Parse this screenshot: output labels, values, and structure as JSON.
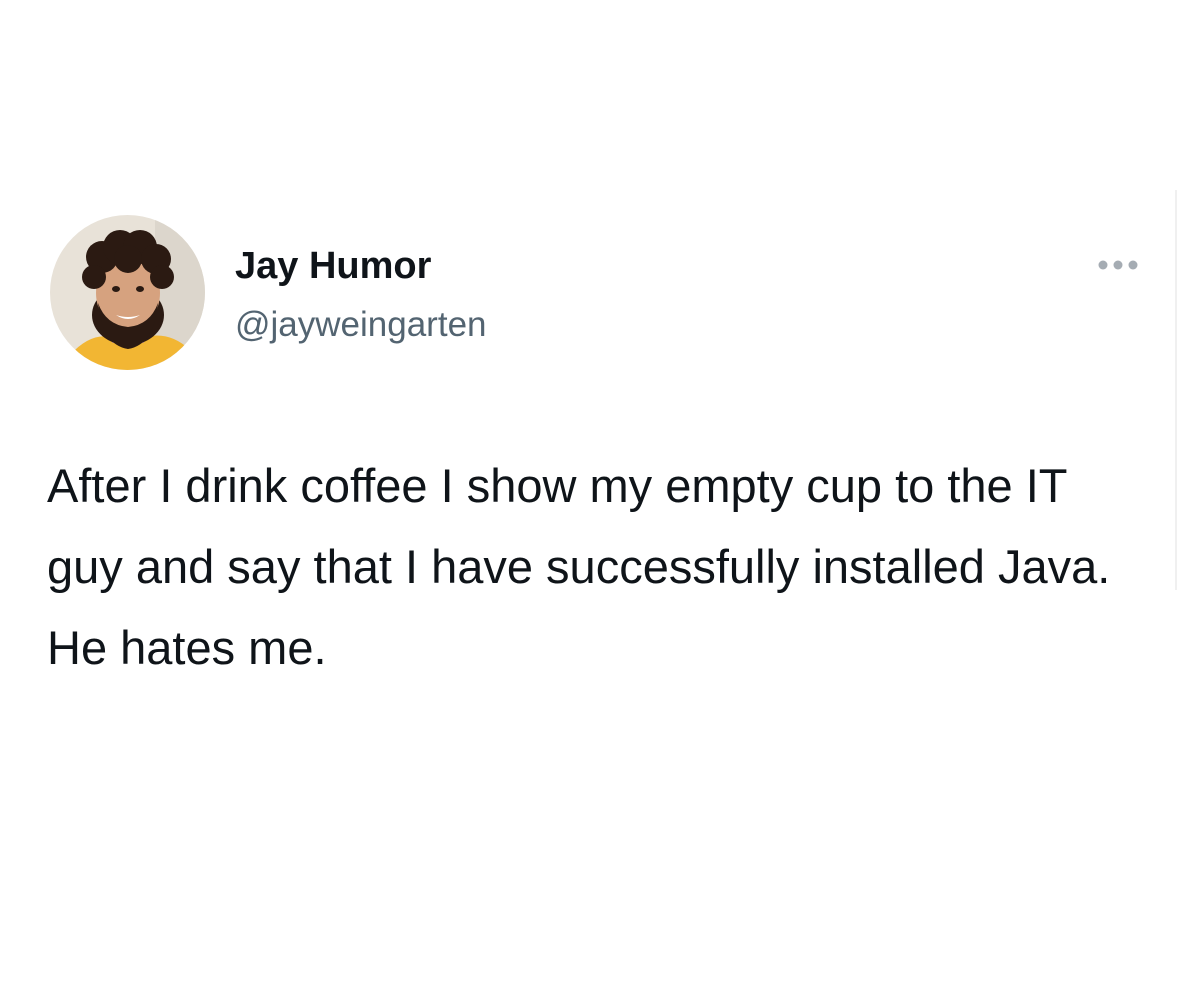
{
  "tweet": {
    "author": {
      "display_name": "Jay Humor",
      "handle": "@jayweingarten",
      "avatar_icon": "profile-photo"
    },
    "more_icon": "more-horizontal-icon",
    "text": "After I drink coffee I show my empty cup to the IT guy and say that I have successfully installed Java. He hates me."
  },
  "colors": {
    "background": "#ffffff",
    "text_primary": "#0f1419",
    "text_secondary": "#536471",
    "more_icon": "#a5acb3"
  }
}
